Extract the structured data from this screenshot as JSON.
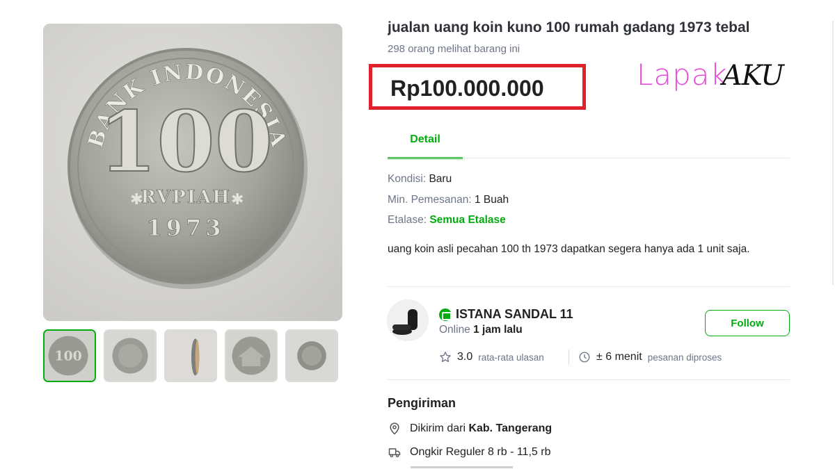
{
  "product": {
    "title": "jualan uang koin kuno 100 rumah gadang 1973 tebal",
    "views": "298 orang melihat barang ini",
    "price": "Rp100.000.000",
    "watermark": {
      "lapak": "Lapak",
      "aku": "AKU"
    }
  },
  "coin": {
    "top_text": "BANK INDONESIA",
    "value": "100",
    "unit": "RVPIAH",
    "year": "1973"
  },
  "tabs": [
    {
      "label": "Detail",
      "active": true
    }
  ],
  "details": {
    "kondisi_label": "Kondisi: ",
    "kondisi_value": "Baru",
    "min_label": "Min. Pemesanan: ",
    "min_value": "1 Buah",
    "etalase_label": "Etalase: ",
    "etalase_value": "Semua Etalase",
    "description": "uang koin asli pecahan 100 th 1973 dapatkan segera hanya ada 1 unit saja."
  },
  "shop": {
    "name": "ISTANA SANDAL 11",
    "online_prefix": "Online",
    "online_value": "1 jam lalu",
    "follow_label": "Follow",
    "rating_value": "3.0",
    "rating_label": "rata-rata ulasan",
    "process_value": "± 6 menit",
    "process_label": "pesanan diproses"
  },
  "shipping": {
    "title": "Pengiriman",
    "from_prefix": "Dikirim dari",
    "from_value": "Kab. Tangerang",
    "ongkir": "Ongkir Reguler 8 rb - 11,5 rb"
  },
  "icons": {
    "rating": "star-icon",
    "process": "clock-icon",
    "location": "location-pin-icon",
    "delivery": "truck-icon"
  },
  "colors": {
    "accent": "#03ac0e",
    "price_highlight": "#e0202b",
    "watermark_pink": "#e64ad8"
  }
}
